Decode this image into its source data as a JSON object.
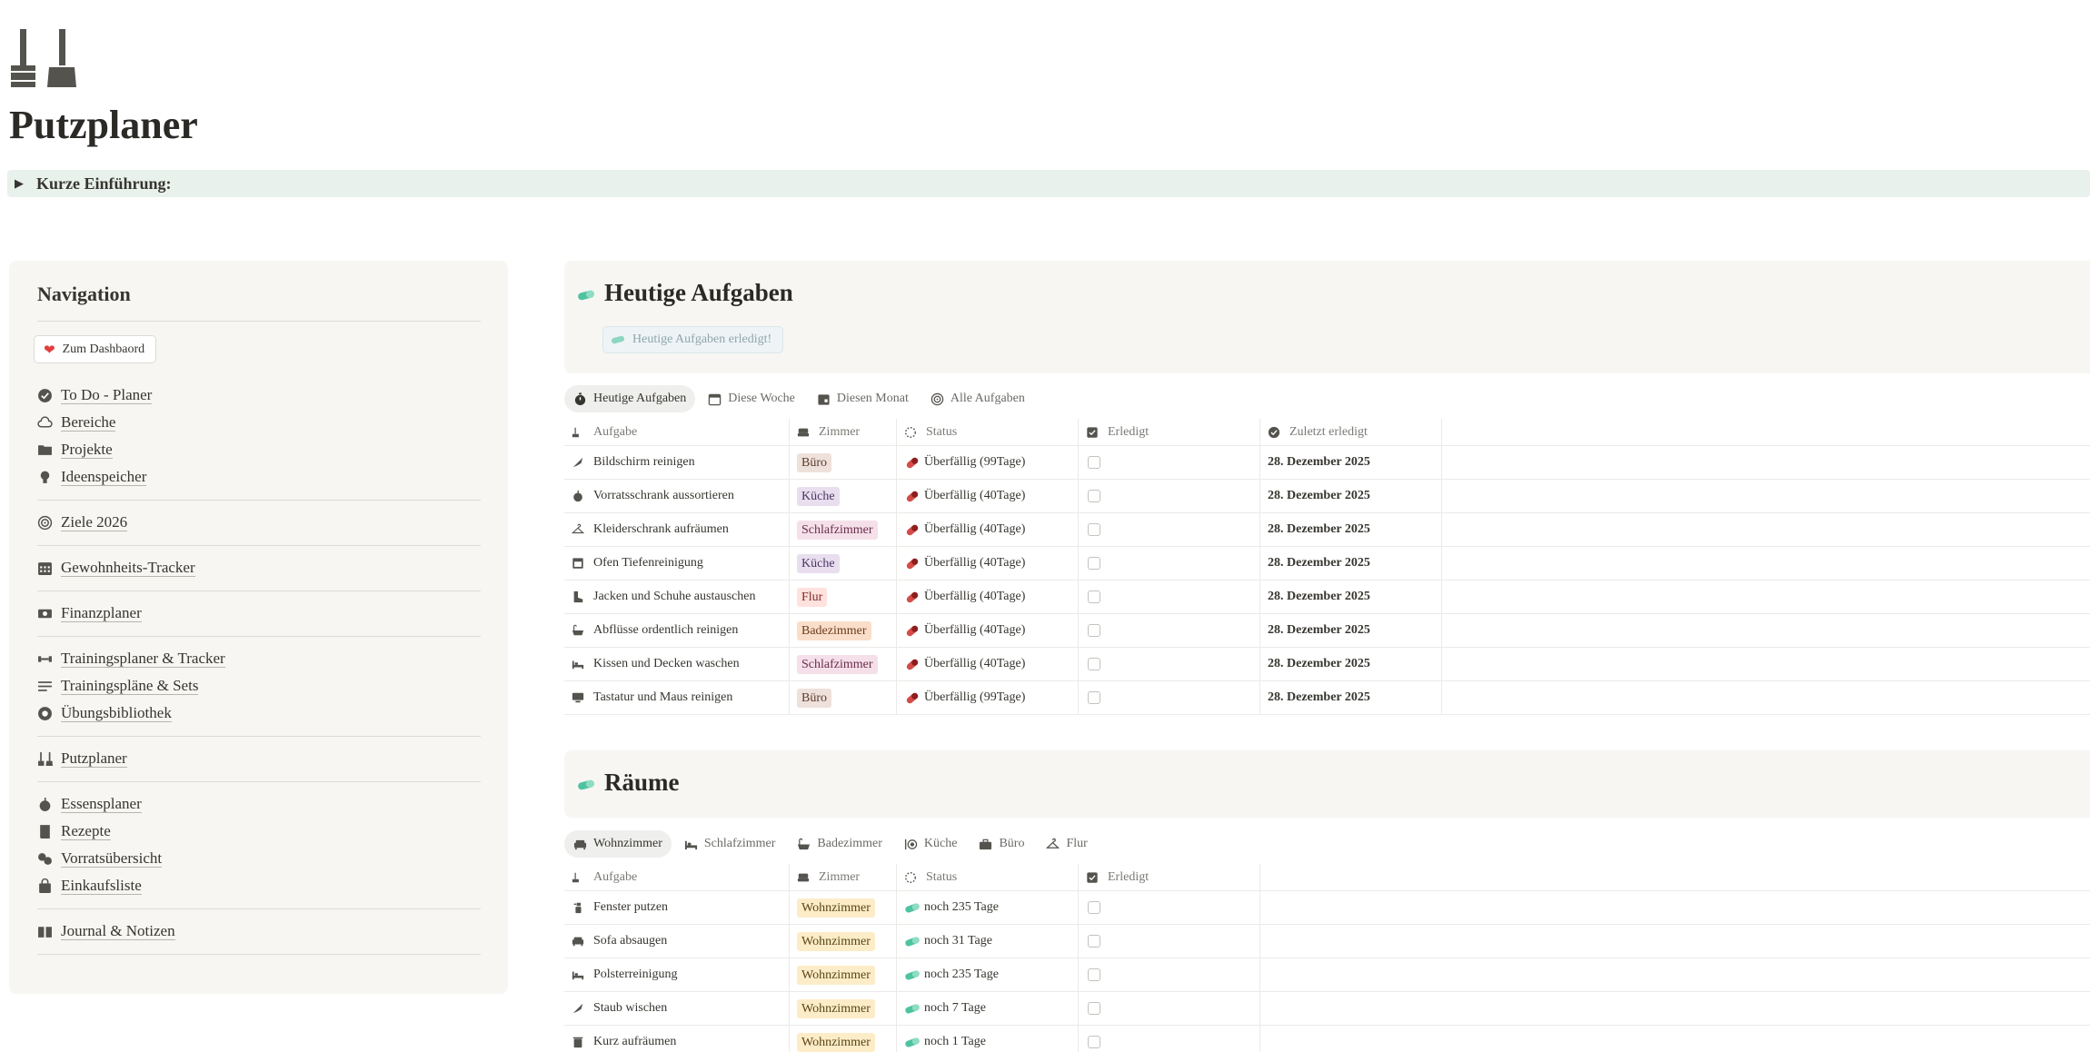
{
  "page": {
    "icon": "broom-and-brush-icon",
    "title": "Putzplaner",
    "intro_toggle": "Kurze Einführung:"
  },
  "sidebar": {
    "title": "Navigation",
    "dashboard_button": "Zum Dashbaord",
    "groups": [
      [
        {
          "label": "To Do - Planer",
          "icon": "check-circle-icon"
        },
        {
          "label": "Bereiche",
          "icon": "cloud-icon"
        },
        {
          "label": "Projekte",
          "icon": "folder-icon"
        },
        {
          "label": "Ideenspeicher",
          "icon": "lightbulb-icon"
        }
      ],
      [
        {
          "label": "Ziele 2026",
          "icon": "target-icon"
        }
      ],
      [
        {
          "label": "Gewohnheits-Tracker",
          "icon": "calendar-grid-icon"
        }
      ],
      [
        {
          "label": "Finanzplaner",
          "icon": "banknote-icon"
        }
      ],
      [
        {
          "label": "Trainingsplaner & Tracker",
          "icon": "dumbbell-icon"
        },
        {
          "label": "Trainingspläne & Sets",
          "icon": "lines-icon"
        },
        {
          "label": "Übungsbibliothek",
          "icon": "record-circle-icon"
        }
      ],
      [
        {
          "label": "Putzplaner",
          "icon": "broom-icon"
        }
      ],
      [
        {
          "label": "Essensplaner",
          "icon": "apple-icon"
        },
        {
          "label": "Rezepte",
          "icon": "book-icon"
        },
        {
          "label": "Vorratsübersicht",
          "icon": "jars-icon"
        },
        {
          "label": "Einkaufsliste",
          "icon": "shopping-bag-icon"
        }
      ],
      [
        {
          "label": "Journal & Notizen",
          "icon": "open-book-icon"
        }
      ]
    ]
  },
  "today": {
    "heading": "Heutige Aufgaben",
    "done_button": "Heutige Aufgaben erledigt!",
    "tabs": [
      {
        "label": "Heutige Aufgaben",
        "icon": "stopwatch-icon",
        "active": true
      },
      {
        "label": "Diese Woche",
        "icon": "calendar-icon",
        "active": false
      },
      {
        "label": "Diesen Monat",
        "icon": "calendar-month-icon",
        "active": false
      },
      {
        "label": "Alle Aufgaben",
        "icon": "target-icon",
        "active": false
      }
    ],
    "columns": {
      "task": "Aufgabe",
      "room": "Zimmer",
      "status": "Status",
      "done": "Erledigt",
      "last": "Zuletzt erledigt"
    },
    "rows": [
      {
        "task": "Bildschirm reinigen",
        "icon": "feather-duster-icon",
        "room": "Büro",
        "status": "Überfällig (99Tage)",
        "last": "28. Dezember 2025"
      },
      {
        "task": "Vorratsschrank aussortieren",
        "icon": "apple-icon",
        "room": "Küche",
        "status": "Überfällig (40Tage)",
        "last": "28. Dezember 2025"
      },
      {
        "task": "Kleiderschrank aufräumen",
        "icon": "hanger-icon",
        "room": "Schlafzimmer",
        "status": "Überfällig (40Tage)",
        "last": "28. Dezember 2025"
      },
      {
        "task": "Ofen Tiefenreinigung",
        "icon": "oven-icon",
        "room": "Küche",
        "status": "Überfällig (40Tage)",
        "last": "28. Dezember 2025"
      },
      {
        "task": "Jacken und Schuhe austauschen",
        "icon": "boot-icon",
        "room": "Flur",
        "status": "Überfällig (40Tage)",
        "last": "28. Dezember 2025"
      },
      {
        "task": "Abflüsse ordentlich reinigen",
        "icon": "bathtub-icon",
        "room": "Badezimmer",
        "status": "Überfällig (40Tage)",
        "last": "28. Dezember 2025"
      },
      {
        "task": "Kissen und Decken waschen",
        "icon": "bed-icon",
        "room": "Schlafzimmer",
        "status": "Überfällig (40Tage)",
        "last": "28. Dezember 2025"
      },
      {
        "task": "Tastatur und Maus reinigen",
        "icon": "monitor-icon",
        "room": "Büro",
        "status": "Überfällig (99Tage)",
        "last": "28. Dezember 2025"
      }
    ]
  },
  "rooms": {
    "heading": "Räume",
    "tabs": [
      {
        "label": "Wohnzimmer",
        "icon": "sofa-icon",
        "active": true
      },
      {
        "label": "Schlafzimmer",
        "icon": "bed-icon",
        "active": false
      },
      {
        "label": "Badezimmer",
        "icon": "bathtub-icon",
        "active": false
      },
      {
        "label": "Küche",
        "icon": "plate-cutlery-icon",
        "active": false
      },
      {
        "label": "Büro",
        "icon": "briefcase-icon",
        "active": false
      },
      {
        "label": "Flur",
        "icon": "hanger-icon",
        "active": false
      }
    ],
    "columns": {
      "task": "Aufgabe",
      "room": "Zimmer",
      "status": "Status",
      "done": "Erledigt"
    },
    "rows": [
      {
        "task": "Fenster putzen",
        "icon": "spray-bottle-icon",
        "room": "Wohnzimmer",
        "status": "noch 235 Tage"
      },
      {
        "task": "Sofa absaugen",
        "icon": "sofa-icon",
        "room": "Wohnzimmer",
        "status": "noch 31 Tage"
      },
      {
        "task": "Polsterreinigung",
        "icon": "bed-icon",
        "room": "Wohnzimmer",
        "status": "noch 235 Tage"
      },
      {
        "task": "Staub wischen",
        "icon": "feather-duster-icon",
        "room": "Wohnzimmer",
        "status": "noch 7 Tage"
      },
      {
        "task": "Kurz aufräumen",
        "icon": "trash-can-icon",
        "room": "Wohnzimmer",
        "status": "noch 1 Tage"
      }
    ]
  },
  "colors": {
    "tag_buero": "#eee0da",
    "tag_kueche": "#e8deee",
    "tag_schlafzimmer": "#f5e0e9",
    "tag_flur": "#ffe2dd",
    "tag_badezimmer": "#fadec9",
    "tag_wohnzimmer": "#fdecc8",
    "pill_green": "#4fc3a1",
    "pill_red": "#d44c47"
  }
}
